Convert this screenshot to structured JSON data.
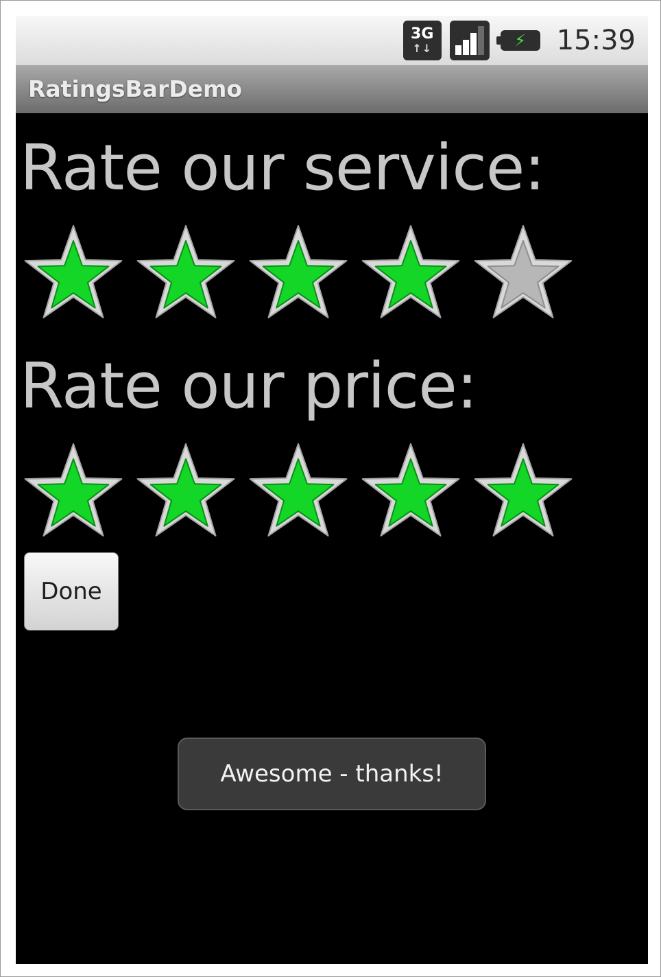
{
  "status_bar": {
    "network_type": "3G",
    "network_arrows": "↑↓",
    "network_icon": "network-3g-icon",
    "signal_icon": "signal-strength-icon",
    "battery_icon": "battery-charging-icon",
    "time": "15:39"
  },
  "app": {
    "title": "RatingsBarDemo"
  },
  "service_rating": {
    "label": "Rate our service:",
    "rating": 4,
    "max": 5
  },
  "price_rating": {
    "label": "Rate our price:",
    "rating": 5,
    "max": 5
  },
  "done_button": {
    "label": "Done"
  },
  "toast": {
    "message": "Awesome - thanks!"
  },
  "colors": {
    "star_filled": "#13d626",
    "star_empty": "#b7b7b7",
    "star_rim": "#d9d9d9",
    "label_text": "#c7c7c7"
  }
}
